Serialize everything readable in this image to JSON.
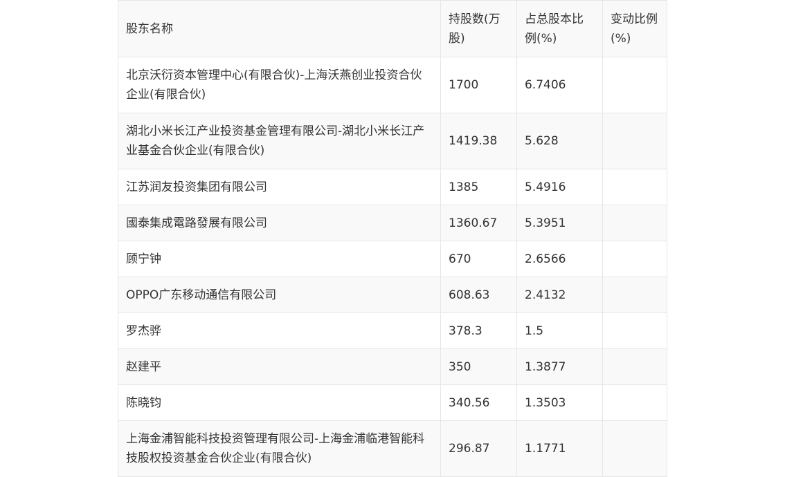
{
  "table": {
    "headers": {
      "name": "股东名称",
      "shares": "持股数(万股)",
      "ratio": "占总股本比例(%)",
      "change": "变动比例(%)"
    },
    "rows": [
      {
        "name": "北京沃衍资本管理中心(有限合伙)-上海沃燕创业投资合伙企业(有限合伙)",
        "shares": "1700",
        "ratio": "6.7406",
        "change": ""
      },
      {
        "name": "湖北小米长江产业投资基金管理有限公司-湖北小米长江产业基金合伙企业(有限合伙)",
        "shares": "1419.38",
        "ratio": "5.628",
        "change": ""
      },
      {
        "name": "江苏润友投资集团有限公司",
        "shares": "1385",
        "ratio": "5.4916",
        "change": ""
      },
      {
        "name": "國泰集成電路發展有限公司",
        "shares": "1360.67",
        "ratio": "5.3951",
        "change": ""
      },
      {
        "name": "顾宁钟",
        "shares": "670",
        "ratio": "2.6566",
        "change": ""
      },
      {
        "name": "OPPO广东移动通信有限公司",
        "shares": "608.63",
        "ratio": "2.4132",
        "change": ""
      },
      {
        "name": "罗杰骅",
        "shares": "378.3",
        "ratio": "1.5",
        "change": ""
      },
      {
        "name": "赵建平",
        "shares": "350",
        "ratio": "1.3877",
        "change": ""
      },
      {
        "name": "陈晓钧",
        "shares": "340.56",
        "ratio": "1.3503",
        "change": ""
      },
      {
        "name": "上海金浦智能科技投资管理有限公司-上海金浦临港智能科技股权投资基金合伙企业(有限合伙)",
        "shares": "296.87",
        "ratio": "1.1771",
        "change": ""
      }
    ]
  }
}
